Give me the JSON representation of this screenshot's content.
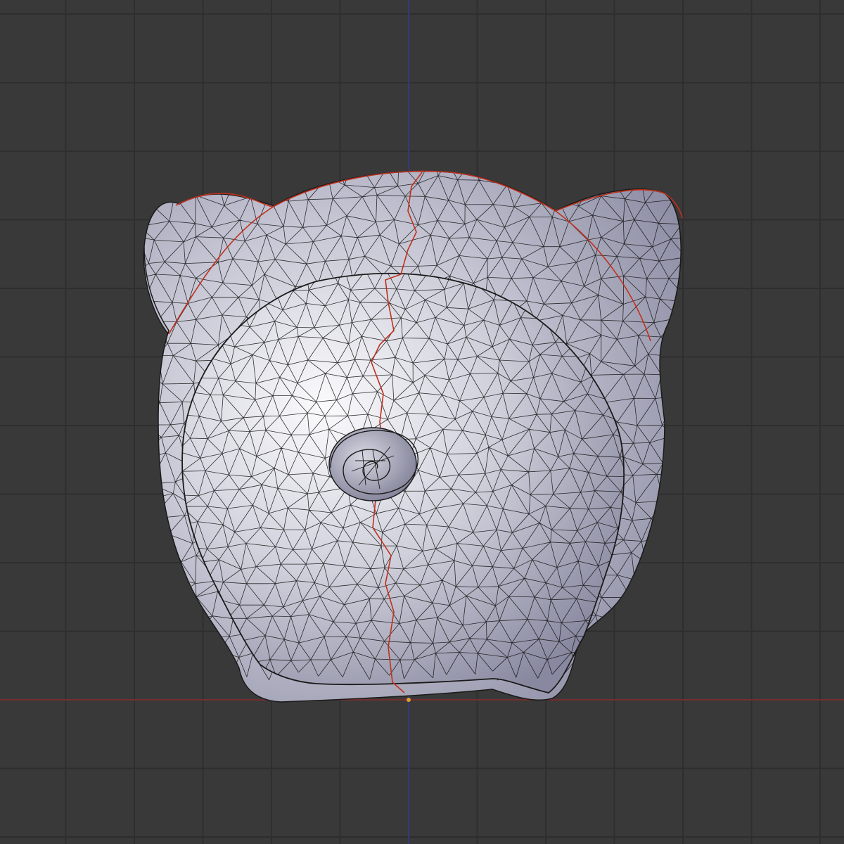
{
  "viewport": {
    "label": "",
    "view": "back-orthographic",
    "mode": "edit",
    "shading": "solid-with-wireframe-overlay",
    "background_color": "#393939",
    "grid_color": "#2e2e2e",
    "x_axis_color": "#8a2e2e",
    "z_axis_color": "#3a3a9a",
    "mesh_color": "#c9c9d6",
    "wire_color": "#111111",
    "seam_color": "#c0301c",
    "origin_color": "#e0a030"
  },
  "mesh": {
    "name": "",
    "description_icon": "bear-head-mesh-icon",
    "features": [
      "head",
      "left-ear",
      "right-ear",
      "snout",
      "nose-swirl",
      "uv-seams"
    ]
  }
}
